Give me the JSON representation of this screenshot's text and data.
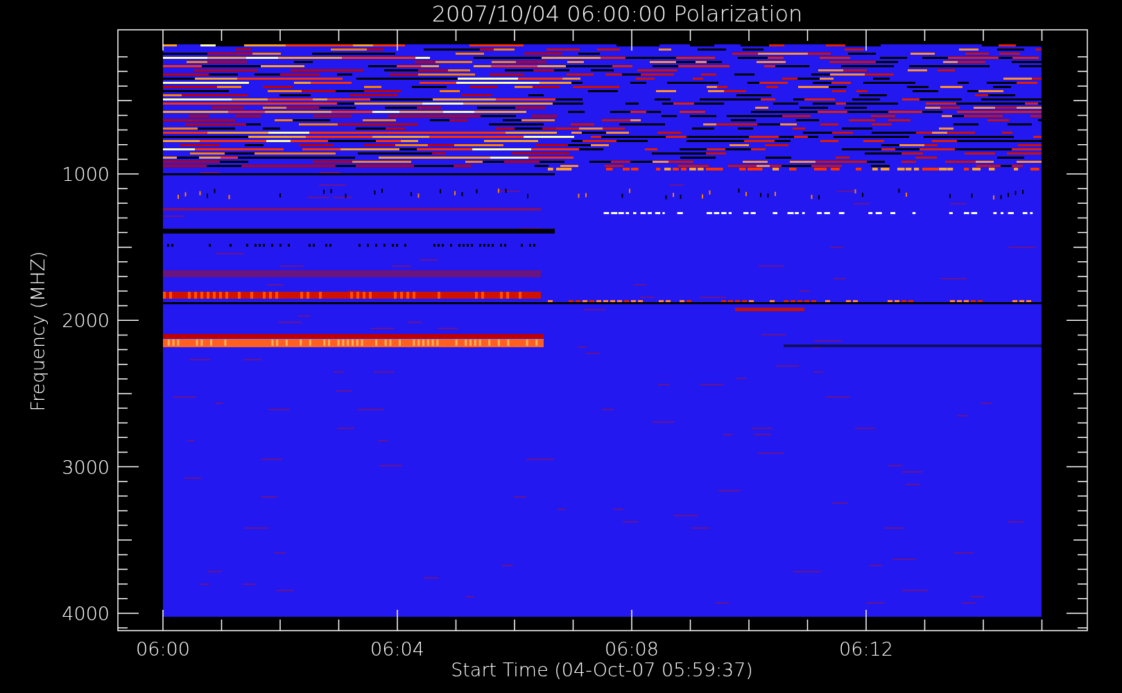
{
  "title": "2007/10/04 06:00:00 Polarization",
  "y_axis": {
    "label": "Frequency (MHZ)",
    "ticks": [
      "1000",
      "2000",
      "3000",
      "4000"
    ]
  },
  "x_axis": {
    "label": "Start Time (04-Oct-07 05:59:37)",
    "ticks": [
      "06:00",
      "06:04",
      "06:08",
      "06:12"
    ]
  }
}
